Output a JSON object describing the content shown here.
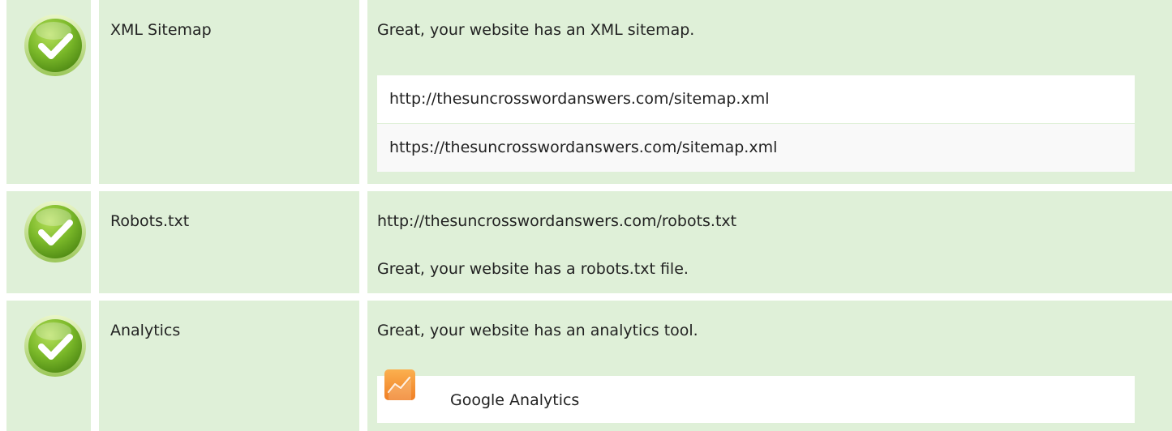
{
  "rows": [
    {
      "status": "pass",
      "label": "XML Sitemap",
      "message": "Great, your website has an XML sitemap.",
      "sitemaps": [
        "http://thesuncrosswordanswers.com/sitemap.xml",
        "https://thesuncrosswordanswers.com/sitemap.xml"
      ]
    },
    {
      "status": "pass",
      "label": "Robots.txt",
      "robots_url": "http://thesuncrosswordanswers.com/robots.txt",
      "message": "Great, your website has a robots.txt file."
    },
    {
      "status": "pass",
      "label": "Analytics",
      "message": "Great, your website has an analytics tool.",
      "tools": [
        {
          "name": "Google Analytics",
          "icon": "google-analytics-icon"
        }
      ]
    }
  ],
  "colors": {
    "pass_background": "#dff0d8",
    "check_green": "#7ab829",
    "analytics_orange": "#f79a3b"
  }
}
